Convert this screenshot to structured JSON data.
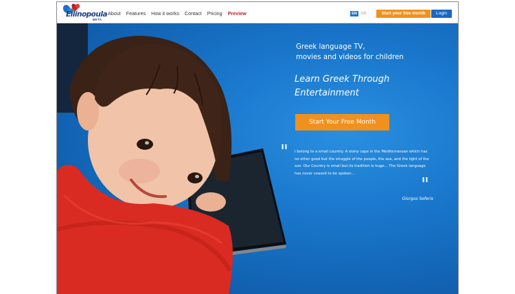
{
  "brand": {
    "name": "Ellinopoula",
    "tag": "BETA"
  },
  "nav": {
    "items": [
      {
        "label": "About"
      },
      {
        "label": "Features"
      },
      {
        "label": "How it works"
      },
      {
        "label": "Contact"
      },
      {
        "label": "Pricing"
      },
      {
        "label": "Preview"
      }
    ]
  },
  "header_actions": {
    "lang_en": "EN",
    "lang_gr": "GR",
    "start_label": "Start your free month",
    "login_label": "Login"
  },
  "hero": {
    "headline_line1": "Greek language TV,",
    "headline_line2": "movies and videos for children",
    "tagline_line1": "Learn Greek Through",
    "tagline_line2": "Entertainment",
    "cta_label": "Start Your Free Month",
    "quote": "I belong to a small country. A stony cape in the Mediterranean which has no other good but the struggle of the people, the sea, and the light of the sun. Our Country is small but its tradition is huge... The Greek language has never ceased to be spoken...",
    "quote_author": "Giorgos Seferis"
  },
  "colors": {
    "accent_orange": "#f0911f",
    "login_blue": "#1a67c4",
    "hero_blue": "#1a78cd",
    "preview_red": "#c0202b",
    "logo_navy": "#1a3f8f"
  },
  "icons": [
    "flower-logo-icon",
    "quote-open-icon",
    "quote-close-icon"
  ]
}
